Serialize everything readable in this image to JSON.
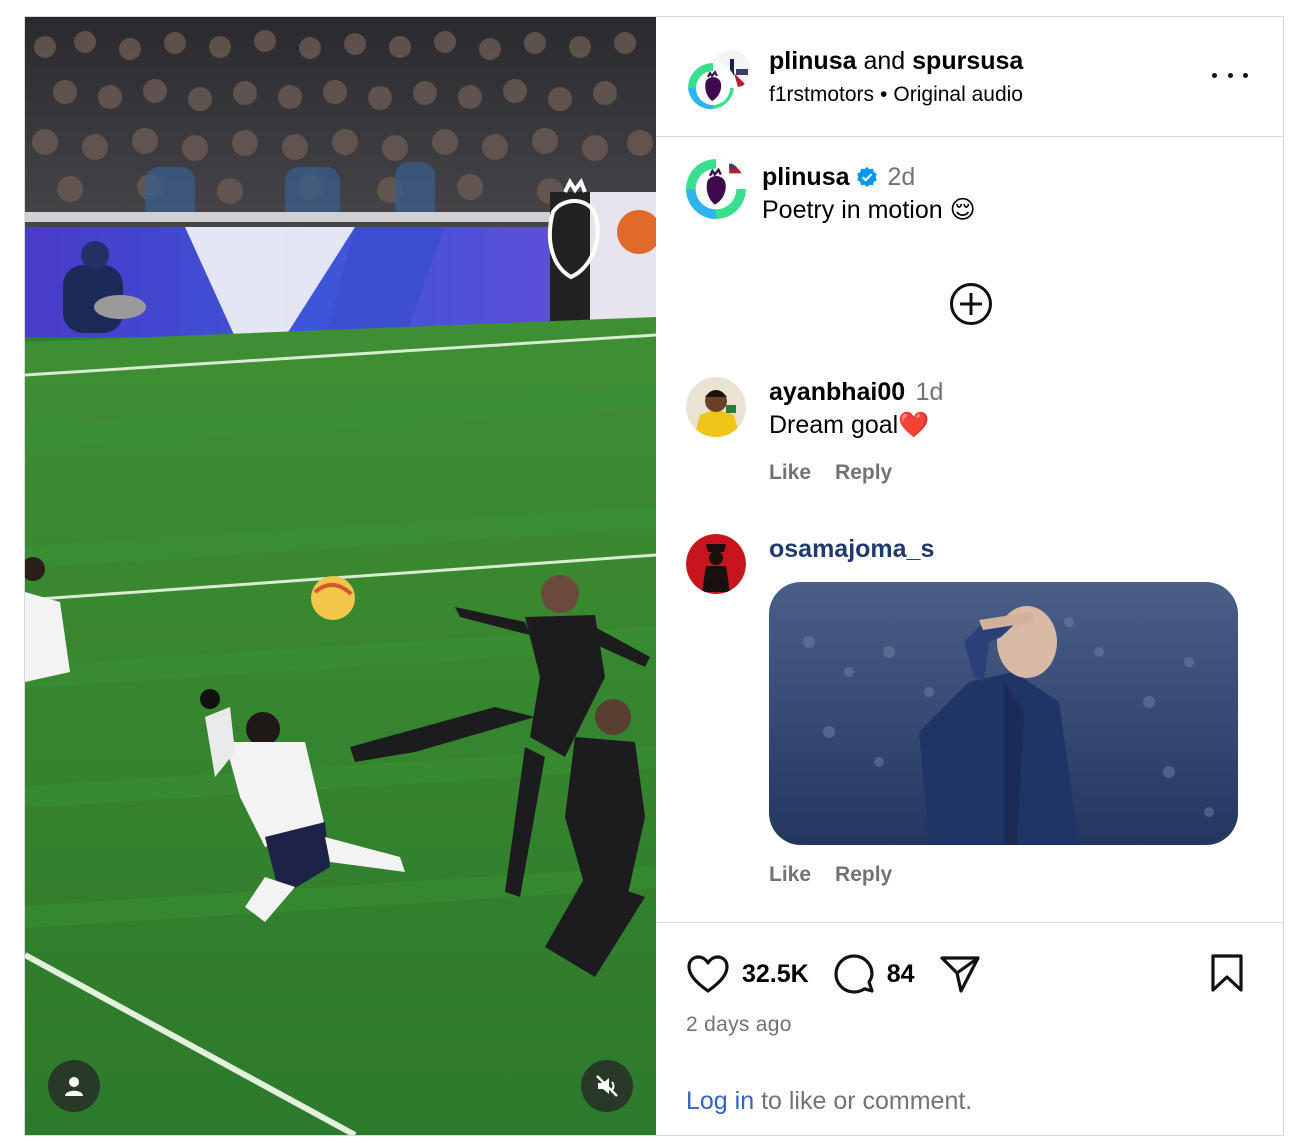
{
  "header": {
    "user1": "plinusa",
    "joiner": "and",
    "user2": "spursusa",
    "subline_user": "f1rstmotors",
    "separator": "•",
    "audio": "Original audio"
  },
  "caption": {
    "username": "plinusa",
    "age": "2d",
    "text": "Poetry in motion 😌"
  },
  "comments": [
    {
      "username": "ayanbhai00",
      "age": "1d",
      "text": "Dream goal❤️",
      "like": "Like",
      "reply": "Reply"
    },
    {
      "username": "osamajoma_s",
      "like": "Like",
      "reply": "Reply"
    }
  ],
  "footer": {
    "likes": "32.5K",
    "comments": "84",
    "date": "2 days ago",
    "login_link": "Log in",
    "login_rest": " to like or comment."
  },
  "colors": {
    "pitch": "#2f7d2e",
    "link": "#3264c8",
    "muted": "#737373",
    "verified": "#0095f6",
    "heart": "#e0245e"
  },
  "icons": [
    "person-icon",
    "mute-icon",
    "more-icon",
    "verified-icon",
    "plus-circle-icon",
    "heart-icon",
    "comment-icon",
    "share-icon",
    "bookmark-icon"
  ]
}
